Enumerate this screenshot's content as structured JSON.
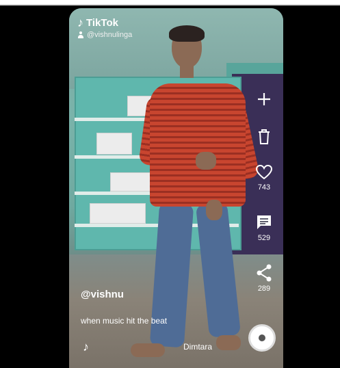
{
  "app": {
    "brand": "TikTok",
    "watermark_handle": "@vishnulinga"
  },
  "actions": {
    "like_count": "743",
    "comment_count": "529",
    "share_count": "289"
  },
  "video": {
    "username": "@vishnu",
    "caption": "when music hit the beat",
    "sound": "Dimtara"
  },
  "icons": {
    "add": "plus-icon",
    "delete": "trash-icon",
    "like": "heart-icon",
    "comment": "comment-icon",
    "share": "share-icon",
    "music": "music-note-icon",
    "disc": "music-disc-icon"
  }
}
